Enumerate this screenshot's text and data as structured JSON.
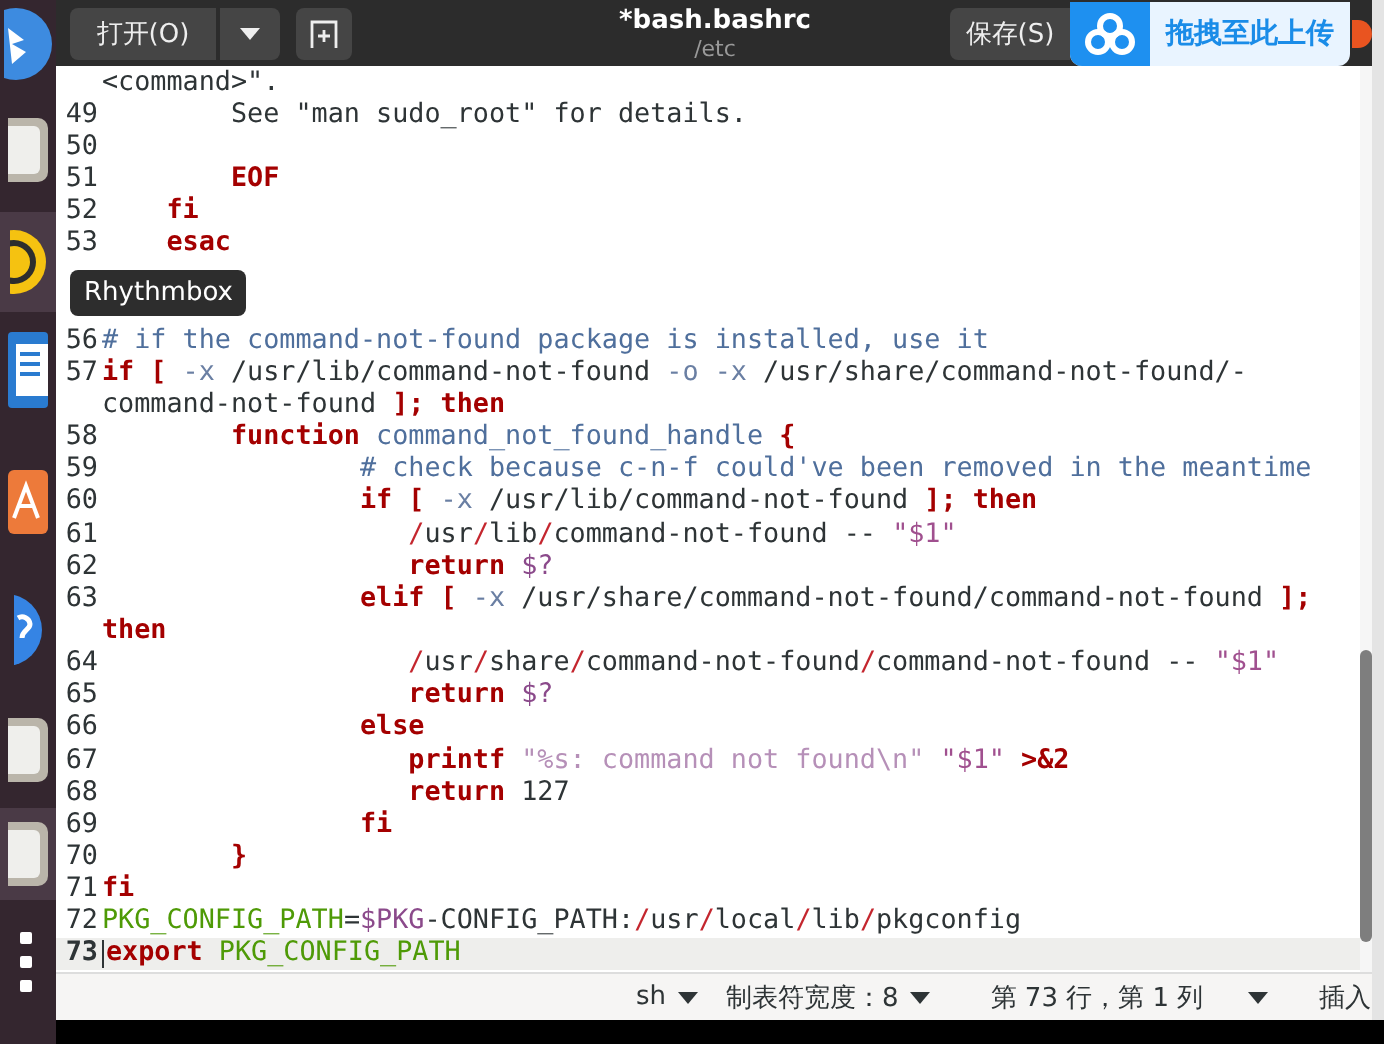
{
  "dock": [
    {
      "kind": "round",
      "active": false
    },
    {
      "kind": "drive",
      "active": false
    },
    {
      "kind": "disc",
      "active": true
    },
    {
      "kind": "document",
      "active": false
    },
    {
      "kind": "bag",
      "active": false
    },
    {
      "kind": "help",
      "active": false
    },
    {
      "kind": "drive",
      "active": false
    },
    {
      "kind": "drive",
      "active": true
    },
    {
      "kind": "grid",
      "active": false
    }
  ],
  "titlebar": {
    "open_button": "打开(O)",
    "title": "*bash.bashrc",
    "subtitle": "/etc",
    "save_button": "保存(S)",
    "upload_badge": "拖拽至此上传"
  },
  "tooltip": "Rhythmbox",
  "editor": {
    "rows": [
      {
        "current": false,
        "tokens": [
          {
            "kind": "p",
            "text": "<command>\"."
          }
        ]
      },
      {
        "number": "49",
        "current": false,
        "tokens": [
          {
            "kind": "p",
            "text": "\tSee \"man sudo_root\" for details."
          }
        ]
      },
      {
        "number": "50",
        "current": false,
        "tokens": []
      },
      {
        "number": "51",
        "current": false,
        "tokens": [
          {
            "kind": "kw",
            "text": "\tEOF"
          }
        ]
      },
      {
        "number": "52",
        "current": false,
        "tokens": [
          {
            "kind": "kw",
            "text": "    fi"
          }
        ]
      },
      {
        "number": "53",
        "current": false,
        "tokens": [
          {
            "kind": "kw",
            "text": "    esac"
          }
        ]
      },
      {
        "current": false,
        "tokens": []
      },
      {
        "current": false,
        "tokens": []
      },
      {
        "number": "56",
        "current": false,
        "tokens": [
          {
            "kind": "cm",
            "text": "# if the command-not-found package is installed, use it"
          }
        ]
      },
      {
        "number": "57",
        "current": false,
        "tokens": [
          {
            "kind": "kw",
            "text": "if ["
          },
          {
            "kind": "op",
            "text": " -x"
          },
          {
            "kind": "p",
            "text": " /usr/lib/command-not-found "
          },
          {
            "kind": "op",
            "text": "-o -x"
          },
          {
            "kind": "p",
            "text": " /usr/share/command-not-found/-"
          }
        ]
      },
      {
        "current": false,
        "tokens": [
          {
            "kind": "p",
            "text": "command-not-found "
          },
          {
            "kind": "kw",
            "text": "]; then"
          }
        ]
      },
      {
        "number": "58",
        "current": false,
        "tokens": [
          {
            "kind": "kw",
            "text": "\tfunction"
          },
          {
            "kind": "fn",
            "text": " command_not_found_handle "
          },
          {
            "kind": "kw",
            "text": "{"
          }
        ]
      },
      {
        "number": "59",
        "current": false,
        "tokens": [
          {
            "kind": "cm",
            "text": "\t\t# check because c-n-f could've been removed in the meantime"
          }
        ]
      },
      {
        "number": "60",
        "current": false,
        "tokens": [
          {
            "kind": "kw",
            "text": "\t\tif ["
          },
          {
            "kind": "op",
            "text": " -x"
          },
          {
            "kind": "p",
            "text": " /usr/lib/command-not-found "
          },
          {
            "kind": "kw",
            "text": "]; then"
          }
        ]
      },
      {
        "number": "61",
        "current": false,
        "tokens": [
          {
            "kind": "sep",
            "text": "\t\t   /"
          },
          {
            "kind": "p",
            "text": "usr"
          },
          {
            "kind": "sep",
            "text": "/"
          },
          {
            "kind": "p",
            "text": "lib"
          },
          {
            "kind": "sep",
            "text": "/"
          },
          {
            "kind": "p",
            "text": "command-not-found -- "
          },
          {
            "kind": "str",
            "text": "\"$1\""
          }
        ]
      },
      {
        "number": "62",
        "current": false,
        "tokens": [
          {
            "kind": "kw",
            "text": "\t\t   return"
          },
          {
            "kind": "var",
            "text": " $?"
          }
        ]
      },
      {
        "number": "63",
        "current": false,
        "tokens": [
          {
            "kind": "kw",
            "text": "\t\telif ["
          },
          {
            "kind": "op",
            "text": " -x"
          },
          {
            "kind": "p",
            "text": " /usr/share/command-not-found/command-not-found "
          },
          {
            "kind": "kw",
            "text": "];"
          }
        ]
      },
      {
        "current": false,
        "tokens": [
          {
            "kind": "kw",
            "text": "then"
          }
        ]
      },
      {
        "number": "64",
        "current": false,
        "tokens": [
          {
            "kind": "sep",
            "text": "\t\t   /"
          },
          {
            "kind": "p",
            "text": "usr"
          },
          {
            "kind": "sep",
            "text": "/"
          },
          {
            "kind": "p",
            "text": "share"
          },
          {
            "kind": "sep",
            "text": "/"
          },
          {
            "kind": "p",
            "text": "command-not-found"
          },
          {
            "kind": "sep",
            "text": "/"
          },
          {
            "kind": "p",
            "text": "command-not-found -- "
          },
          {
            "kind": "str",
            "text": "\"$1\""
          }
        ]
      },
      {
        "number": "65",
        "current": false,
        "tokens": [
          {
            "kind": "kw",
            "text": "\t\t   return"
          },
          {
            "kind": "var",
            "text": " $?"
          }
        ]
      },
      {
        "number": "66",
        "current": false,
        "tokens": [
          {
            "kind": "kw",
            "text": "\t\telse"
          }
        ]
      },
      {
        "number": "67",
        "current": false,
        "tokens": [
          {
            "kind": "kw",
            "text": "\t\t   printf"
          },
          {
            "kind": "lstr",
            "text": " \"%s: command not found\\n\""
          },
          {
            "kind": "str",
            "text": " \"$1\""
          },
          {
            "kind": "kw",
            "text": " >&2"
          }
        ]
      },
      {
        "number": "68",
        "current": false,
        "tokens": [
          {
            "kind": "kw",
            "text": "\t\t   return"
          },
          {
            "kind": "p",
            "text": " 127"
          }
        ]
      },
      {
        "number": "69",
        "current": false,
        "tokens": [
          {
            "kind": "kw",
            "text": "\t\tfi"
          }
        ]
      },
      {
        "number": "70",
        "current": false,
        "tokens": [
          {
            "kind": "kw",
            "text": "\t}"
          }
        ]
      },
      {
        "number": "71",
        "current": false,
        "tokens": [
          {
            "kind": "kw",
            "text": "fi"
          }
        ]
      },
      {
        "number": "72",
        "current": false,
        "tokens": [
          {
            "kind": "green",
            "text": "PKG_CONFIG_PATH"
          },
          {
            "kind": "p",
            "text": "="
          },
          {
            "kind": "var",
            "text": "$PKG"
          },
          {
            "kind": "p",
            "text": "-CONFIG_PATH:"
          },
          {
            "kind": "sep",
            "text": "/"
          },
          {
            "kind": "p",
            "text": "usr"
          },
          {
            "kind": "sep",
            "text": "/"
          },
          {
            "kind": "p",
            "text": "local"
          },
          {
            "kind": "sep",
            "text": "/"
          },
          {
            "kind": "p",
            "text": "lib"
          },
          {
            "kind": "sep",
            "text": "/"
          },
          {
            "kind": "p",
            "text": "pkgconfig"
          }
        ]
      },
      {
        "number": "73",
        "current": true,
        "tokens": [
          {
            "kind": "kw",
            "text": "export"
          },
          {
            "kind": "green",
            "text": " PKG_CONFIG_PATH"
          }
        ]
      }
    ]
  },
  "status_bar": {
    "language": "sh",
    "tab_width": "制表符宽度：8",
    "position": "第 73 行，第 1 列",
    "mode": "插入"
  }
}
